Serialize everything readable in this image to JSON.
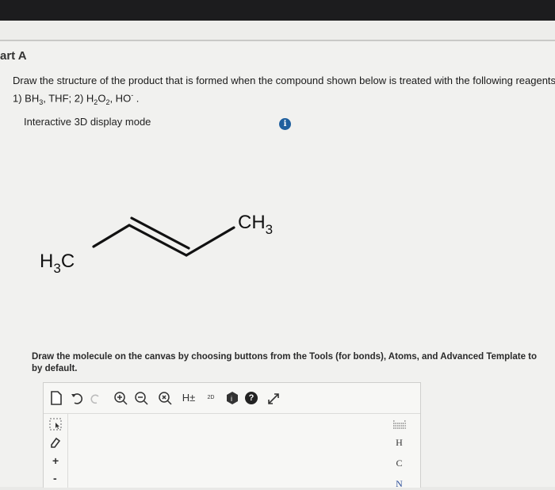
{
  "part": {
    "title": "art A"
  },
  "question": {
    "line1": "Draw the structure of the product that is formed when the compound shown below is treated with the following reagents:",
    "line2_prefix": "1) BH",
    "line2_sub1": "3",
    "line2_mid1": ", THF; 2) H",
    "line2_sub2": "2",
    "line2_mid2": "O",
    "line2_sub3": "2",
    "line2_mid3": ", HO",
    "line2_sup": "-",
    "line2_end": " ."
  },
  "display_mode": {
    "label": "Interactive 3D display mode",
    "info_glyph": "i"
  },
  "molecule": {
    "left_label_main": "H",
    "left_label_sub": "3",
    "left_label_end": "C",
    "right_label_main": "CH",
    "right_label_sub": "3"
  },
  "instructions": {
    "line1": "Draw the molecule on the canvas by choosing buttons from the Tools (for bonds), Atoms, and Advanced Template to",
    "line2": "by default."
  },
  "editor": {
    "toolbar": {
      "h_label": "H±",
      "label_2d": "2D",
      "help_glyph": "?"
    },
    "atoms": [
      "H",
      "C",
      "N"
    ],
    "plus": "+",
    "minus": "-"
  }
}
